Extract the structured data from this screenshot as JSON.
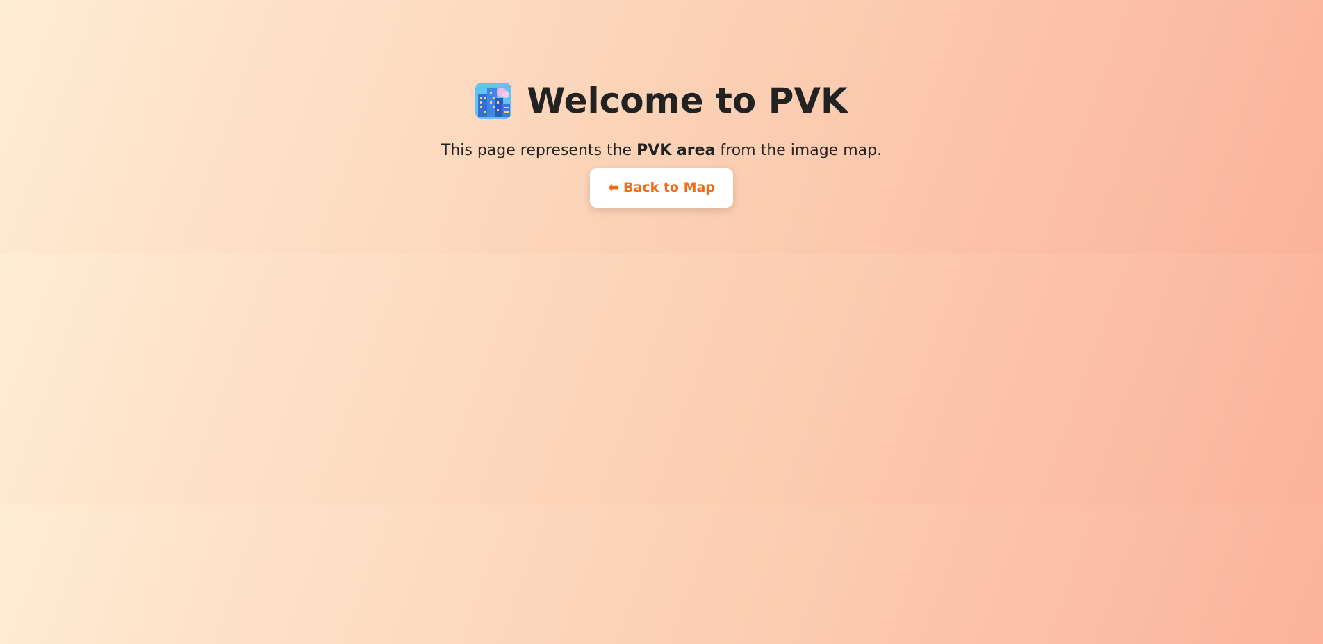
{
  "page": {
    "title": "Welcome to PVK",
    "icon": "cityscape-icon",
    "subtitle": {
      "before": "This page represents the ",
      "emphasis": "PVK area",
      "after": " from the image map."
    },
    "back_button": {
      "arrow": "⬅",
      "label": "Back to Map"
    }
  },
  "colors": {
    "background_start": "#ffecd4",
    "background_end": "#fbb39b",
    "text": "#222222",
    "button_text": "#f06a17",
    "button_bg": "#ffffff"
  }
}
